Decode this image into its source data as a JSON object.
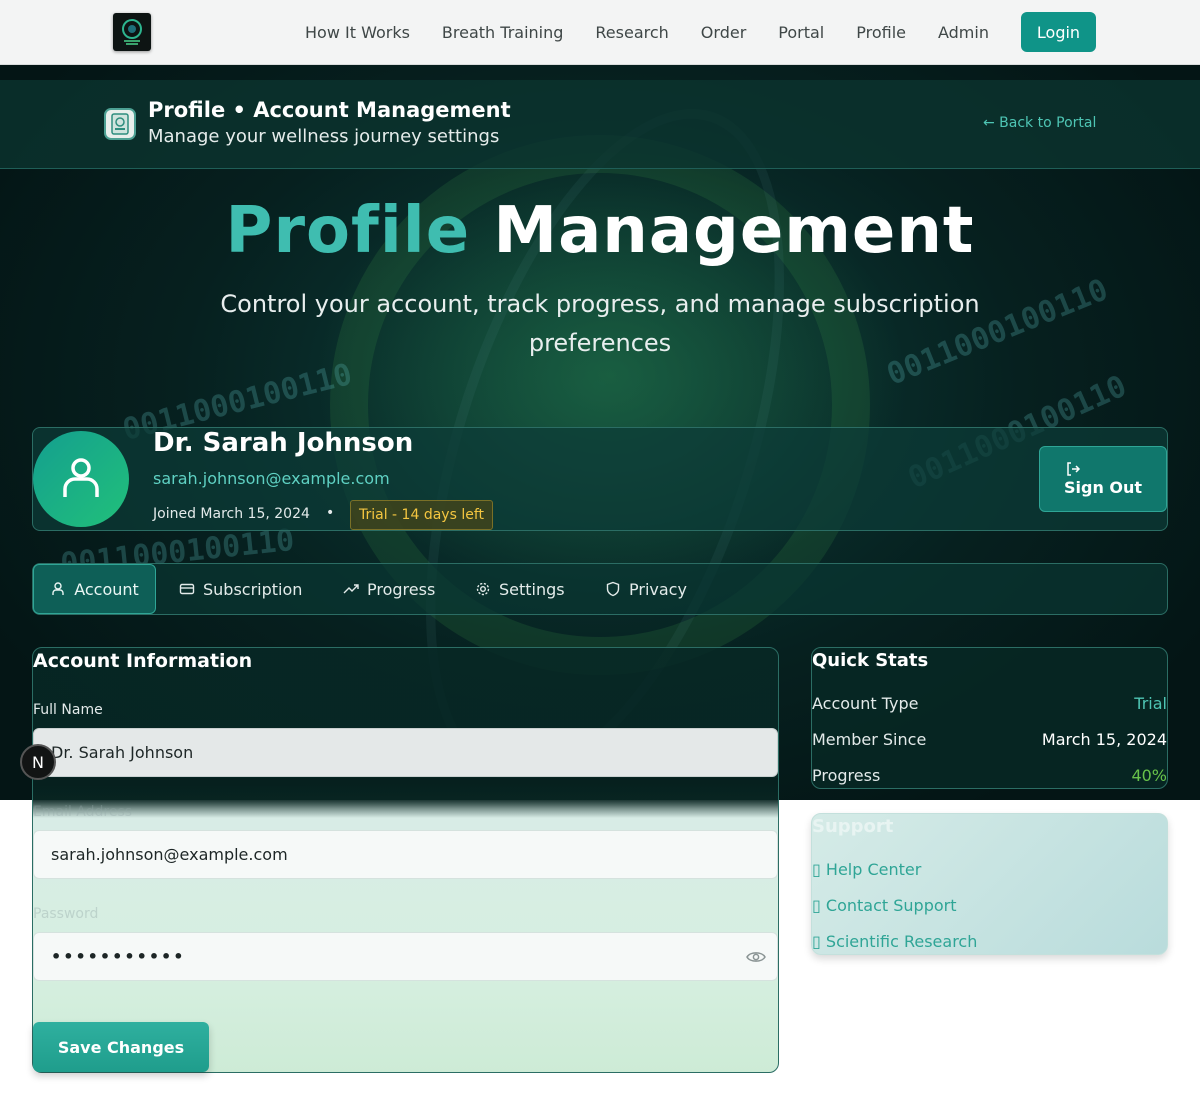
{
  "nav": {
    "links": [
      "How It Works",
      "Breath Training",
      "Research",
      "Order",
      "Portal",
      "Profile",
      "Admin"
    ],
    "login_label": "Login"
  },
  "header": {
    "title": "Profile • Account Management",
    "subtitle": "Manage your wellness journey settings",
    "back_label": "← Back to Portal"
  },
  "hero": {
    "title_accent": "Profile",
    "title_rest": "Management",
    "tagline": "Control your account, track progress, and manage subscription preferences",
    "binary_text": "0011000100110"
  },
  "profile": {
    "name": "Dr. Sarah Johnson",
    "email": "sarah.johnson@example.com",
    "joined": "Joined March 15, 2024",
    "separator": "•",
    "trial_badge": "Trial - 14 days left",
    "signout_label": "Sign Out"
  },
  "tabs": [
    {
      "label": "Account",
      "icon": "user-icon",
      "active": true
    },
    {
      "label": "Subscription",
      "icon": "credit-card-icon",
      "active": false
    },
    {
      "label": "Progress",
      "icon": "trending-up-icon",
      "active": false
    },
    {
      "label": "Settings",
      "icon": "gear-icon",
      "active": false
    },
    {
      "label": "Privacy",
      "icon": "shield-icon",
      "active": false
    }
  ],
  "account_info": {
    "title": "Account Information",
    "full_name_label": "Full Name",
    "full_name_value": "Dr. Sarah Johnson",
    "email_label": "Email Address",
    "email_value": "sarah.johnson@example.com",
    "password_label": "Password",
    "password_value": "•••••••••••",
    "save_label": "Save Changes"
  },
  "quick_stats": {
    "title": "Quick Stats",
    "rows": [
      {
        "label": "Account Type",
        "value": "Trial"
      },
      {
        "label": "Member Since",
        "value": "March 15, 2024"
      },
      {
        "label": "Progress",
        "value": "40%"
      }
    ]
  },
  "support": {
    "title": "Support",
    "items": [
      "Help Center",
      "Contact Support",
      "Scientific Research"
    ],
    "item_icon_glyph": "▯"
  },
  "dev_badge": "N",
  "colors": {
    "accent": "#0f9488",
    "accent_light": "#3fbdb0",
    "trial_yellow": "#f4c640",
    "progress_green": "#68c24a",
    "dark_bg": "#06201f"
  }
}
